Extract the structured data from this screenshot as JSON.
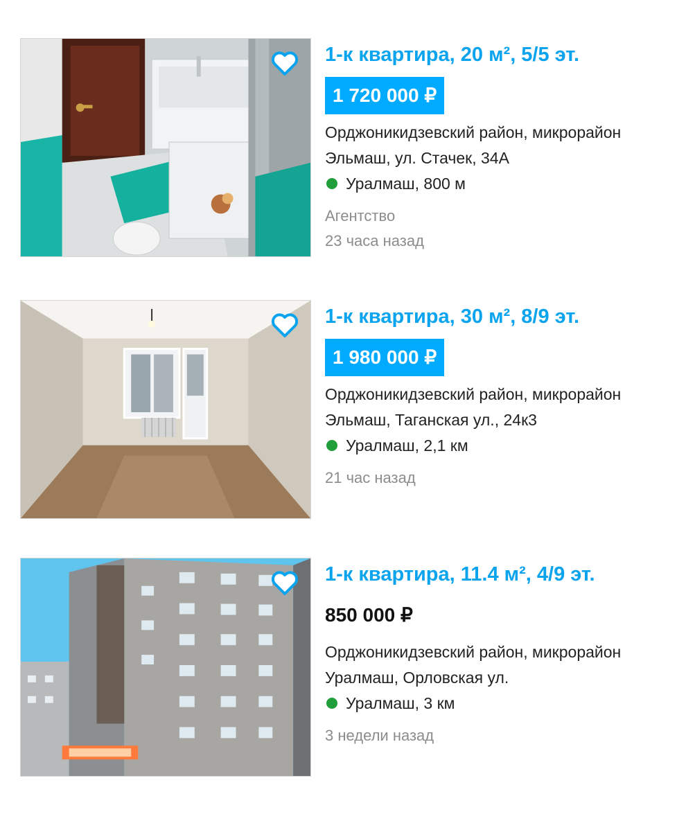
{
  "colors": {
    "title": "#0aa3ee",
    "price_badge": "#00aaff",
    "metro_dot": "#1f9e3a",
    "muted_text": "#8c8c8c"
  },
  "listings": [
    {
      "title": "1-к квартира, 20 м², 5/5 эт.",
      "price": "1 720 000 ₽",
      "price_highlighted": true,
      "address_line1": "Орджоникидзевский район, микрорайон",
      "address_line2": "Эльмаш, ул. Стачек, 34А",
      "metro": "Уралмаш, 800 м",
      "seller": "Агентство",
      "posted": "23 часа назад",
      "favorite_icon": "heart-outline-icon"
    },
    {
      "title": "1-к квартира, 30 м², 8/9 эт.",
      "price": "1 980 000 ₽",
      "price_highlighted": true,
      "address_line1": "Орджоникидзевский район, микрорайон",
      "address_line2": "Эльмаш, Таганская ул., 24к3",
      "metro": "Уралмаш, 2,1 км",
      "posted": "21 час назад",
      "favorite_icon": "heart-outline-icon"
    },
    {
      "title": "1-к квартира, 11.4 м², 4/9 эт.",
      "price": "850 000 ₽",
      "price_highlighted": false,
      "address_line1": "Орджоникидзевский район, микрорайон",
      "address_line2": "Уралмаш, Орловская ул.",
      "metro": "Уралмаш, 3 км",
      "posted": "3 недели назад",
      "favorite_icon": "heart-outline-icon"
    }
  ]
}
